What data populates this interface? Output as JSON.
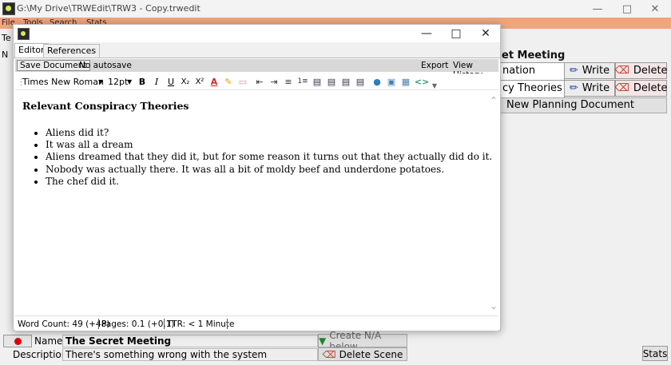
{
  "main_window": {
    "title": "G:\\My Drive\\TRWEdit\\TRW3 - Copy.trwedit",
    "menu": [
      "File",
      "Tools",
      "Search",
      "Stats"
    ],
    "left_labels": [
      "Te",
      "N"
    ],
    "scene_heading": "et Meeting",
    "rows": [
      {
        "name": "nation",
        "write_label": "Write",
        "delete_label": "Delete"
      },
      {
        "name": "cy Theories",
        "write_label": "Write",
        "delete_label": "Delete"
      }
    ],
    "new_planning_label": "New Planning Document",
    "name_label": "Name:",
    "name_value": "The Secret Meeting",
    "create_label": "Create N/A below",
    "description_label": "Description:",
    "description_value": "There's something wrong with the system",
    "delete_scene_label": "Delete Scene",
    "stats_label": "Stats"
  },
  "dialog": {
    "tabs": [
      "Editor",
      "References"
    ],
    "save_label": "Save Document",
    "autosave_label": "No autosave",
    "export_label": "Export",
    "history_label": "View History",
    "font_name": "Times New Roman",
    "font_size": "12pt",
    "toolbar_icons": [
      "bold-icon",
      "italic-icon",
      "underline-icon",
      "subscript-icon",
      "superscript-icon",
      "font-color-icon",
      "highlight-icon",
      "eraser-icon",
      "outdent-icon",
      "indent-icon",
      "bullet-list-icon",
      "numbered-list-icon",
      "align-left-icon",
      "align-center-icon",
      "align-right-icon",
      "justify-icon",
      "link-icon",
      "image-icon",
      "table-icon",
      "code-icon"
    ],
    "document": {
      "heading": "Relevant Conspiracy Theories",
      "items": [
        "Aliens did it?",
        "It was all a dream",
        "Aliens dreamed that they did it, but for some reason it turns out that they actually did do it.",
        "Nobody was actually there. It was all a bit of moldy beef and underdone potatoes.",
        "The chef did it."
      ]
    },
    "status": {
      "word_count": "Word Count:  49 (+48)",
      "pages": "Pages:  0.1 (+0.1)",
      "ttr": "TTR:  < 1 Minute"
    }
  },
  "colors": {
    "menu_bar": "#f0a57c",
    "toolbar_strip": "#d8d8d8",
    "write_icon": "#1a3fa8",
    "delete_icon": "#c0392b",
    "create_arrow": "#1e8a2a",
    "record_dot": "#dd0000"
  }
}
